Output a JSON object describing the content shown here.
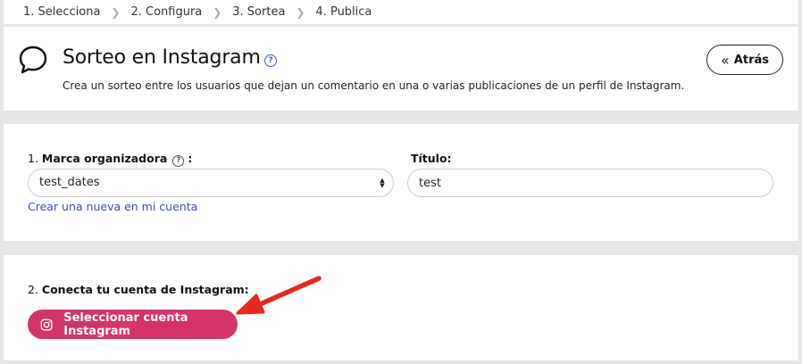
{
  "steps": [
    {
      "label": "1. Selecciona"
    },
    {
      "label": "2. Configura"
    },
    {
      "label": "3. Sortea"
    },
    {
      "label": "4. Publica"
    }
  ],
  "header": {
    "title": "Sorteo en Instagram",
    "subtitle": "Crea un sorteo entre los usuarios que dejan un comentario en una o varias publicaciones de un perfil de Instagram.",
    "back_label": "Atrás"
  },
  "form": {
    "brand_label_num": "1.",
    "brand_label": "Marca organizadora",
    "brand_label_colon": ":",
    "brand_value": "test_dates",
    "create_link": "Crear una nueva en mi cuenta",
    "title_label": "Título:",
    "title_value": "test"
  },
  "connect": {
    "label_num": "2.",
    "label": "Conecta tu cuenta de Instagram:",
    "button_label": "Seleccionar cuenta Instagram"
  },
  "colors": {
    "accent": "#d6336c",
    "link": "#3d4bb5",
    "annotation_arrow": "#e8261c"
  }
}
